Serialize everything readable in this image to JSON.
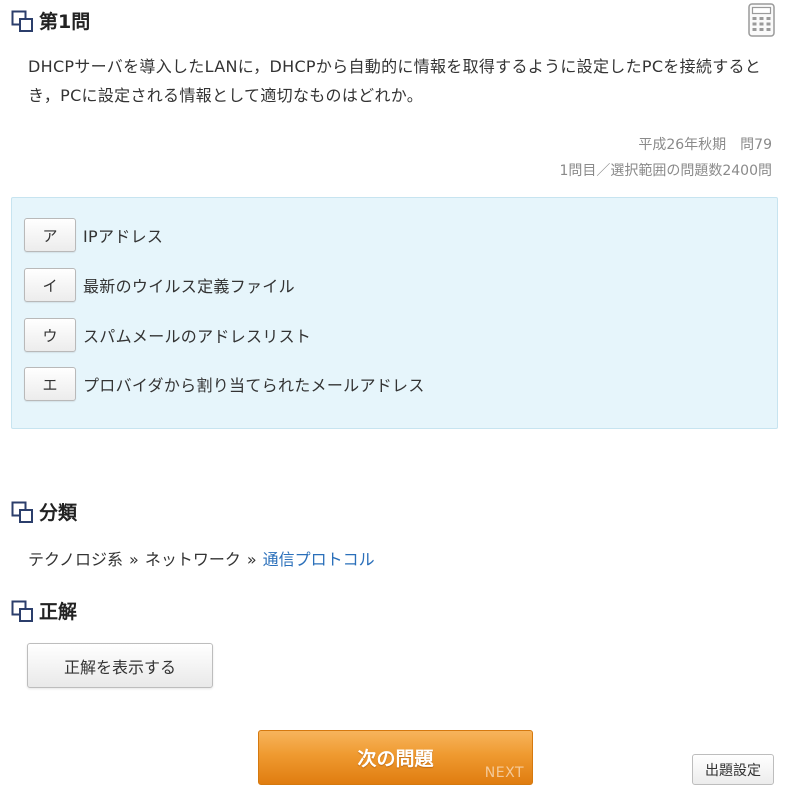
{
  "question": {
    "title": "第1問",
    "text": "DHCPサーバを導入したLANに，DHCPから自動的に情報を取得するように設定したPCを接続するとき，PCに設定される情報として適切なものはどれか。",
    "exam": "平成26年秋期　問79",
    "progress": "1問目／選択範囲の問題数2400問"
  },
  "choices": [
    {
      "key": "ア",
      "text": "IPアドレス"
    },
    {
      "key": "イ",
      "text": "最新のウイルス定義ファイル"
    },
    {
      "key": "ウ",
      "text": "スパムメールのアドレスリスト"
    },
    {
      "key": "エ",
      "text": "プロバイダから割り当てられたメールアドレス"
    }
  ],
  "category": {
    "title": "分類",
    "level1": "テクノロジ系",
    "sep": "»",
    "level2": "ネットワーク",
    "level3": "通信プロトコル"
  },
  "answer": {
    "title": "正解",
    "show_label": "正解を表示する"
  },
  "nav": {
    "next_label": "次の問題",
    "next_sub": "NEXT",
    "settings_label": "出題設定"
  },
  "colors": {
    "accent_orange": "#ef9a30",
    "choices_bg": "#e6f5fb",
    "link": "#2a6fba",
    "icon_navy": "#2b3e6b"
  }
}
